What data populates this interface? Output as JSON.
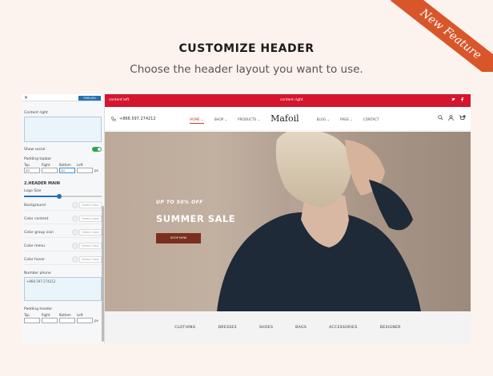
{
  "ribbon": {
    "label": "New Feature",
    "color": "#d8562a"
  },
  "hero": {
    "title": "CUSTOMIZE HEADER",
    "subtitle": "Choose the header layout you want to use."
  },
  "panel": {
    "publish_label": "PUBLISH",
    "content_right_label": "Content right",
    "show_social_label": "Show social",
    "padding_topbar_label": "Padding topbar",
    "padding_sides": [
      "Top",
      "Right",
      "Bottom",
      "Left"
    ],
    "padding_topbar_values": [
      "20",
      "",
      "20",
      ""
    ],
    "unit": "px",
    "header_main_title": "2.HEADER MAIN",
    "logo_size_label": "Logo Size",
    "logo_size_fraction": 0.45,
    "color_rows": [
      {
        "label": "Background",
        "button": "Select Color"
      },
      {
        "label": "Color content",
        "button": "Select Color"
      },
      {
        "label": "Color group icon",
        "button": "Select Color"
      },
      {
        "label": "Color menu",
        "button": "Select Color"
      },
      {
        "label": "Color hover",
        "button": "Select Color"
      }
    ],
    "number_phone_label": "Number phone",
    "number_phone_value": "+866.597.274212",
    "padding_header_label": "Padding header"
  },
  "site": {
    "topbar": {
      "left": "content left",
      "right": "content right",
      "color": "#d4152e"
    },
    "phone": "+866.597.274212",
    "nav_left": [
      {
        "label": "HOME",
        "active": true
      },
      {
        "label": "SHOP"
      },
      {
        "label": "PRODUCTS"
      }
    ],
    "logo": "Mafoil",
    "nav_right": [
      {
        "label": "BLOG"
      },
      {
        "label": "PAGE"
      },
      {
        "label": "CONTACT"
      }
    ],
    "cart_count": "0",
    "banner": {
      "kicker": "UP TO 50% OFF",
      "title": "SUMMER SALE",
      "button": "SHOP NOW"
    },
    "categories": [
      "CLOTHING",
      "DRESSES",
      "SHOES",
      "BAGS",
      "ACCESSORIES",
      "DESIGNER"
    ]
  }
}
